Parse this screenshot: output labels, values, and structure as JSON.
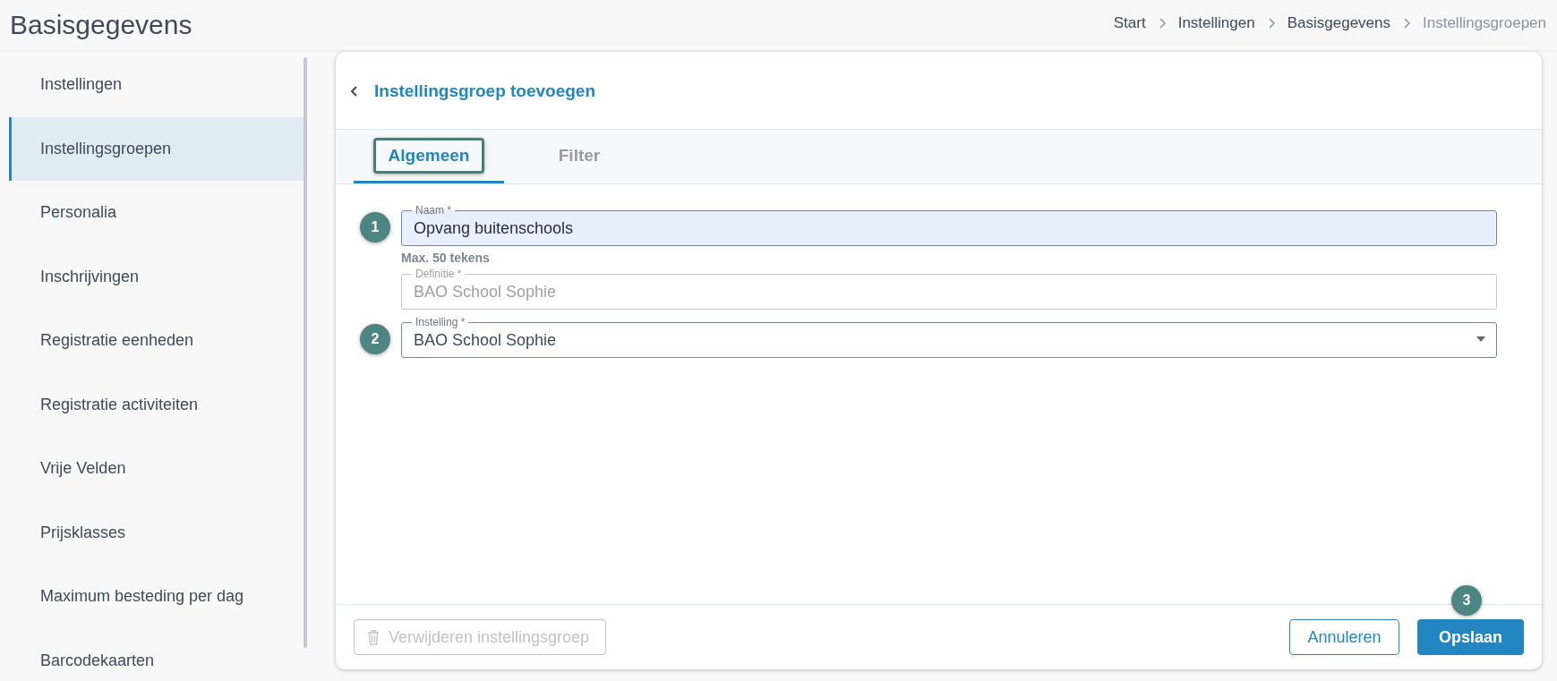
{
  "page_title": "Basisgegevens",
  "breadcrumb": [
    {
      "label": "Start",
      "current": false
    },
    {
      "label": "Instellingen",
      "current": false
    },
    {
      "label": "Basisgegevens",
      "current": false
    },
    {
      "label": "Instellingsgroepen",
      "current": true
    }
  ],
  "sidebar": {
    "items": [
      {
        "label": "Instellingen",
        "selected": false
      },
      {
        "label": "Instellingsgroepen",
        "selected": true
      },
      {
        "label": "Personalia",
        "selected": false
      },
      {
        "label": "Inschrijvingen",
        "selected": false
      },
      {
        "label": "Registratie eenheden",
        "selected": false
      },
      {
        "label": "Registratie activiteiten",
        "selected": false
      },
      {
        "label": "Vrije Velden",
        "selected": false
      },
      {
        "label": "Prijsklasses",
        "selected": false
      },
      {
        "label": "Maximum besteding per dag",
        "selected": false
      },
      {
        "label": "Barcodekaarten",
        "selected": false
      }
    ]
  },
  "card": {
    "title": "Instellingsgroep toevoegen",
    "tabs": [
      {
        "label": "Algemeen",
        "selected": true,
        "highlighted": true
      },
      {
        "label": "Filter",
        "selected": false,
        "highlighted": false
      }
    ],
    "fields": [
      {
        "kind": "text",
        "label": "Naam *",
        "value": "Opvang buitenschools",
        "hint": "Max. 50 tekens",
        "disabled": false,
        "autofilled": true,
        "callout": "1"
      },
      {
        "kind": "text",
        "label": "Definitie *",
        "value": "BAO School Sophie",
        "disabled": true,
        "autofilled": false
      },
      {
        "kind": "select",
        "label": "Instelling *",
        "value": "BAO School Sophie",
        "disabled": false,
        "autofilled": false,
        "callout": "2"
      }
    ],
    "footer": {
      "delete_button": {
        "label": "Verwijderen instellingsgroep",
        "disabled": true
      },
      "cancel_button": "Annuleren",
      "save_button": {
        "label": "Opslaan",
        "callout": "3"
      }
    }
  }
}
